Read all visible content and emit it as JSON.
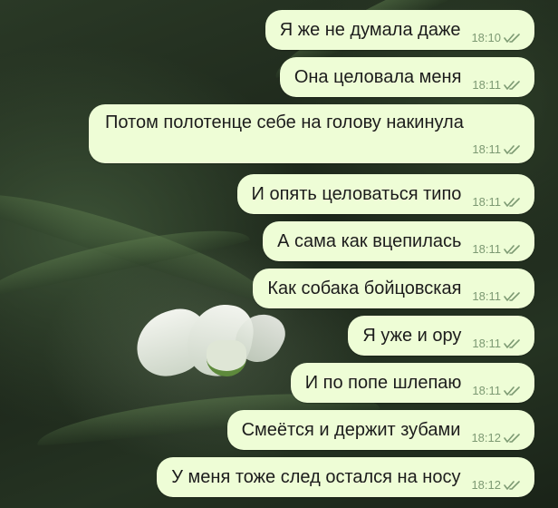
{
  "messages": [
    {
      "text": "Я же не думала даже",
      "time": "18:10"
    },
    {
      "text": "Она целовала меня",
      "time": "18:11"
    },
    {
      "text": "Потом полотенце себе на голову накинула",
      "time": "18:11"
    },
    {
      "text": "И опять целоваться типо",
      "time": "18:11"
    },
    {
      "text": "А сама как вцепилась",
      "time": "18:11"
    },
    {
      "text": "Как собака бойцовская",
      "time": "18:11"
    },
    {
      "text": "Я уже и ору",
      "time": "18:11"
    },
    {
      "text": "И по попе шлепаю",
      "time": "18:11"
    },
    {
      "text": "Смеётся и держит зубами",
      "time": "18:12"
    },
    {
      "text": "У меня тоже след остался на носу",
      "time": "18:12"
    }
  ],
  "icons": {
    "read_status": "double-check-icon"
  },
  "colors": {
    "bubble": "#eefdd6",
    "text": "#1c1c1c",
    "meta": "#7d9a73"
  }
}
